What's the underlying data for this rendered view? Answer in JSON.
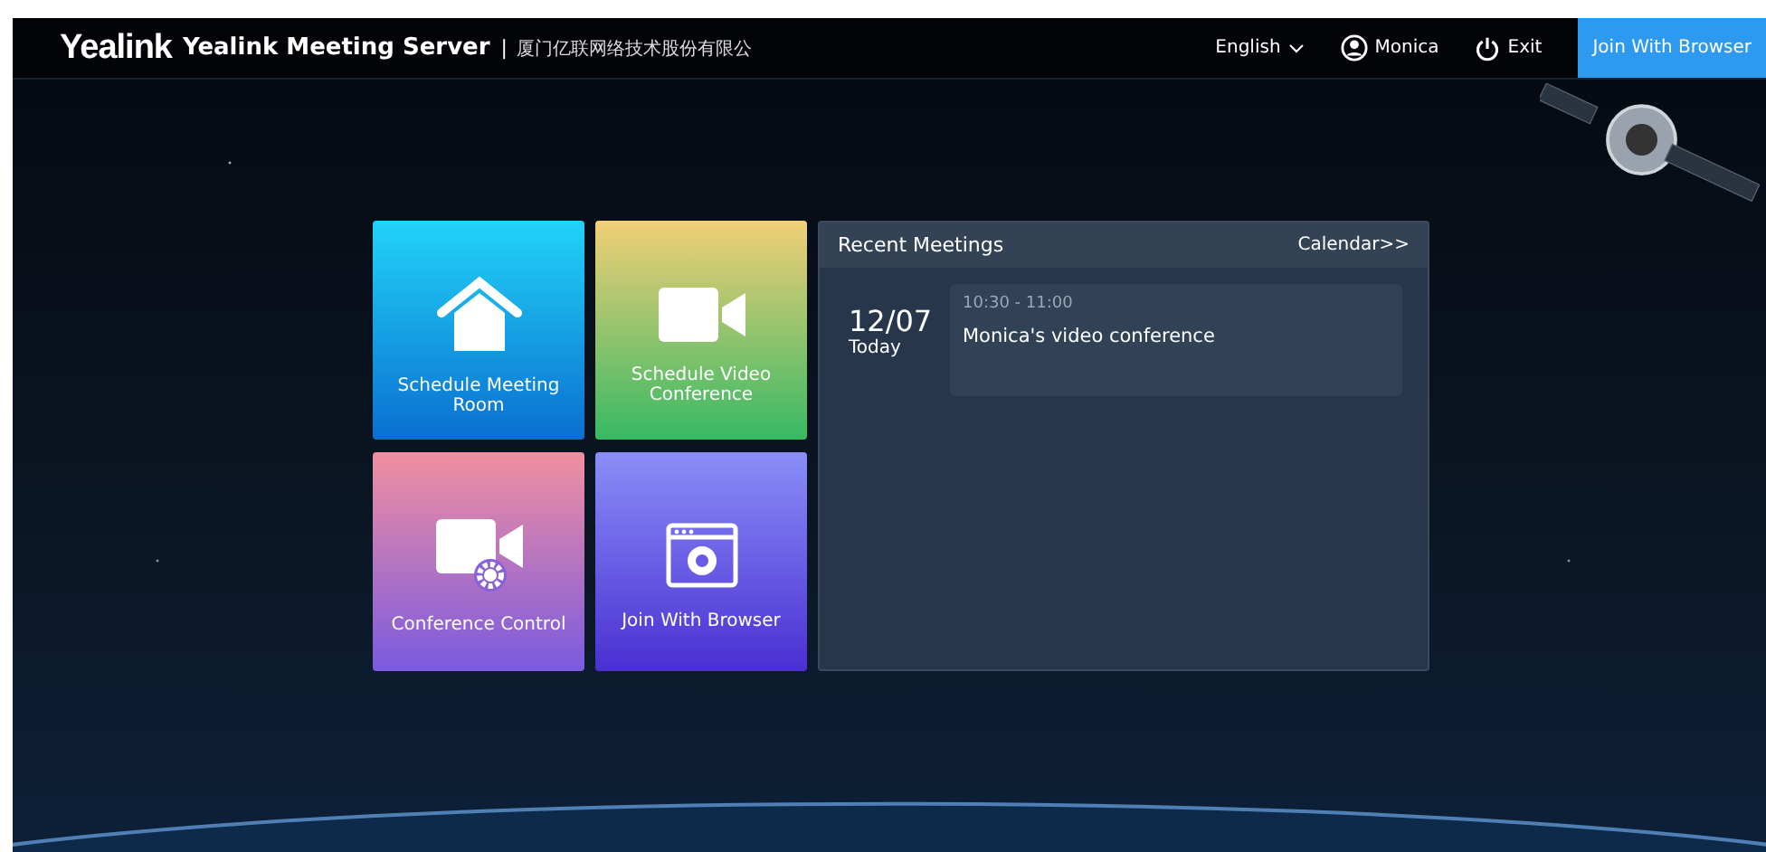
{
  "header": {
    "logo": "Yealink",
    "product": "Yealink Meeting Server",
    "separator": "|",
    "company": "厦门亿联网络技术股份有限公",
    "language": "English",
    "user": "Monica",
    "exit": "Exit",
    "join_button": "Join With Browser"
  },
  "tiles": [
    {
      "kind": "room",
      "label": "Schedule Meeting Room"
    },
    {
      "kind": "video",
      "label": "Schedule Video Conference"
    },
    {
      "kind": "control",
      "label": "Conference Control"
    },
    {
      "kind": "browser",
      "label": "Join With Browser"
    }
  ],
  "recent": {
    "title": "Recent Meetings",
    "calendar_link": "Calendar>>",
    "date": "12/07",
    "day": "Today",
    "meetings": [
      {
        "time": "10:30 - 11:00",
        "name": "Monica's video conference"
      }
    ]
  }
}
